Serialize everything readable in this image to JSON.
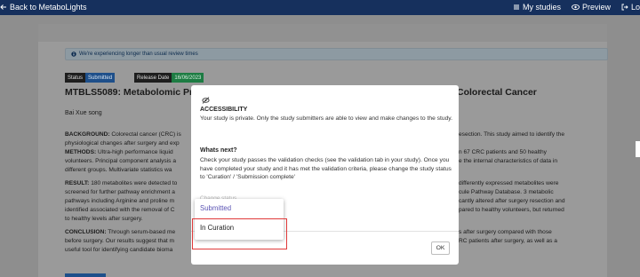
{
  "topbar": {
    "back_label": "Back to MetaboLights",
    "my_studies": "My studies",
    "preview": "Preview",
    "logout": "Lo"
  },
  "alert": {
    "text": "We're experiencing longer than usual review times"
  },
  "status": {
    "label": "Status",
    "value": "Submitted"
  },
  "release": {
    "label": "Release Date",
    "value": "16/06/2023"
  },
  "study": {
    "title_left": "MTBLS5089: Metabolomic Prof",
    "title_right": "Colorectal Cancer",
    "author": "Bai Xue song",
    "abstract_left": [
      {
        "bold": "BACKGROUND:",
        "text": " Colorectal cancer (CRC) is"
      },
      {
        "bold": "",
        "text": "physiological changes after surgery and exp"
      },
      {
        "bold": "METHODS:",
        "text": " Ultra-high performance liquid"
      },
      {
        "bold": "",
        "text": "volunteers. Principal component analysis a"
      },
      {
        "bold": "",
        "text": "different groups. Multivariate statistics wa"
      },
      {
        "bold": "RESULT:",
        "text": " 180 metabolites were detected to"
      },
      {
        "bold": "",
        "text": "screened for further pathway enrichment a"
      },
      {
        "bold": "",
        "text": "pathways including Arginine and proline m"
      },
      {
        "bold": "",
        "text": "identified associated with the removal of C"
      },
      {
        "bold": "",
        "text": "to healthy levels after surgery."
      },
      {
        "bold": "CONCLUSION:",
        "text": " Through serum-based me"
      },
      {
        "bold": "",
        "text": "before surgery. Our results suggest that m"
      },
      {
        "bold": "",
        "text": "useful tool for identifying candidate bioma"
      }
    ],
    "abstract_right": [
      "esection. This study aimed to identify the",
      "",
      "n 67 CRC patients and 50 healthy",
      "e the internal characteristics of data in",
      "",
      "differently expressed metabolites were",
      "cule Pathway Database. 3 metabolic",
      "cantly altered after surgery resection and",
      "pared to healthy volunteers, but returned",
      "",
      "s after surgery compared with those",
      "RC patients after surgery, as well as a",
      ""
    ]
  },
  "modal": {
    "access_heading": "ACCESSIBILITY",
    "access_text": "Your study is private. Only the study submitters are able to view and make changes to the study.",
    "next_heading": "Whats next?",
    "next_text": "Check your study passes the validation checks (see the validation tab in your study). Once you have completed your study and it has met the validation criteria, please change the study status to 'Curation' / 'Submission complete'",
    "faded_label": "Change status",
    "ok_label": "OK"
  },
  "dropdown": {
    "options": [
      "Submitted",
      "In Curation"
    ],
    "selected": "Submitted",
    "highlighted": "In Curation"
  },
  "colors": {
    "topbar": "#16305d",
    "status_badge": "#1e4f8a",
    "release_badge": "#1d7c43",
    "highlight_border": "#e03a3a",
    "selected_option": "#5b54b4"
  }
}
